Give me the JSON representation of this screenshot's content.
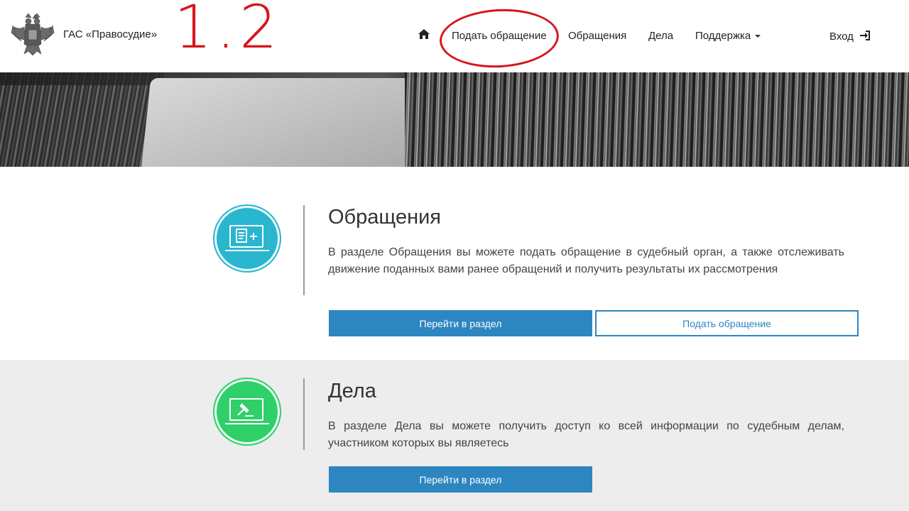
{
  "header": {
    "brand": "ГАС «Правосудие»",
    "annotation": "1.2",
    "nav": {
      "home_icon": "home-icon",
      "submit_appeal": "Подать обращение",
      "appeals": "Обращения",
      "cases": "Дела",
      "support": "Поддержка",
      "login": "Вход",
      "login_icon": "sign-in-icon"
    }
  },
  "sections": [
    {
      "icon": "laptop-document-plus-icon",
      "accent": "#29b6cf",
      "title": "Обращения",
      "text": "В разделе Обращения вы можете подать обращение в судебный орган, а также отслеживать движение поданных вами ранее обращений и получить результаты их рассмотрения",
      "primary_button": "Перейти в раздел",
      "secondary_button": "Подать обращение"
    },
    {
      "icon": "laptop-gavel-icon",
      "accent": "#2fcf6a",
      "title": "Дела",
      "text": "В разделе Дела вы можете получить доступ ко всей информации по судебным делам, участником которых вы являетесь",
      "primary_button": "Перейти в раздел"
    }
  ],
  "colors": {
    "primary": "#2e86c1",
    "annotation_red": "#d7141b"
  }
}
